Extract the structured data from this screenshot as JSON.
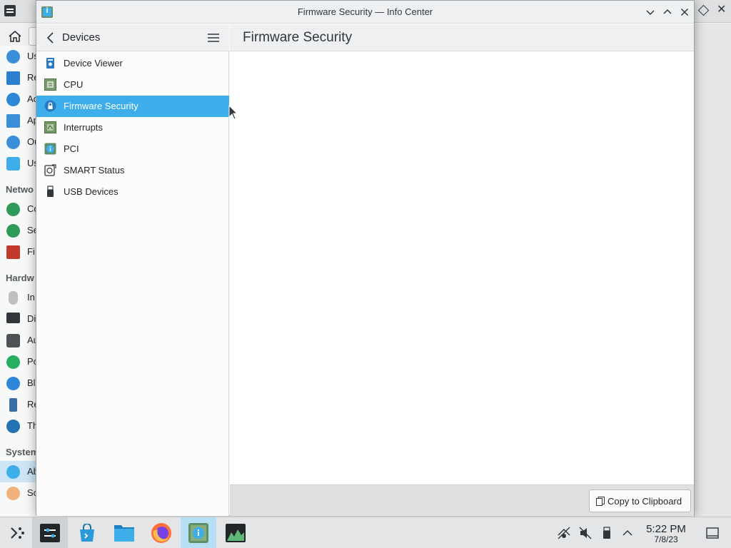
{
  "window": {
    "title": "Firmware Security — Info Center"
  },
  "sidebar": {
    "title": "Devices",
    "items": [
      {
        "label": "Device Viewer",
        "icon": "device-viewer-icon"
      },
      {
        "label": "CPU",
        "icon": "cpu-chip-icon"
      },
      {
        "label": "Firmware Security",
        "icon": "lock-shield-icon",
        "selected": true
      },
      {
        "label": "Interrupts",
        "icon": "interrupts-chip-icon"
      },
      {
        "label": "PCI",
        "icon": "pci-info-icon"
      },
      {
        "label": "SMART Status",
        "icon": "disk-health-icon"
      },
      {
        "label": "USB Devices",
        "icon": "usb-stick-icon"
      }
    ]
  },
  "content": {
    "title": "Firmware Security",
    "copy_button_label": "Copy to Clipboard"
  },
  "background_window": {
    "categories": [
      "Netwo",
      "Hardw",
      "System"
    ],
    "items": [
      "Us",
      "Re",
      "Ac",
      "Ap",
      "Ou",
      "Us",
      "Co",
      "Se",
      "Fi",
      "In",
      "Di",
      "Au",
      "Po",
      "Bl",
      "Re",
      "Th",
      "Ab",
      "So"
    ]
  },
  "taskbar": {
    "apps": [
      "application-launcher",
      "system-settings",
      "discover",
      "dolphin-files",
      "firefox",
      "info-center",
      "system-monitor"
    ],
    "clock_time": "5:22 PM",
    "clock_date": "7/8/23"
  },
  "colors": {
    "accent": "#3daee9",
    "selection_text": "#ffffff",
    "window_bg": "#eff0f1"
  }
}
